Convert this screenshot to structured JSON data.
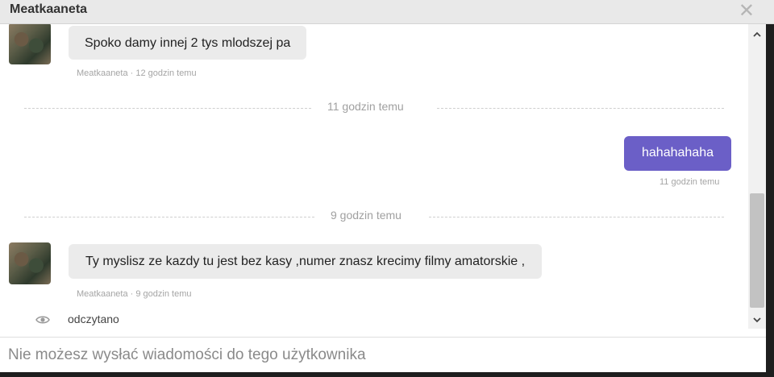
{
  "window": {
    "title": "Meatkaaneta",
    "close_icon": "close-icon"
  },
  "messages": [
    {
      "direction": "in",
      "text": "Spoko damy innej 2 tys mlodszej pa",
      "meta": "Meatkaaneta · 12 godzin temu"
    },
    {
      "direction": "out",
      "text": "hahahahaha",
      "meta": "11 godzin temu"
    },
    {
      "direction": "in",
      "text": "Ty myslisz ze kazdy tu jest bez kasy ,numer znasz krecimy filmy amatorskie ,",
      "meta": "Meatkaaneta · 9 godzin temu"
    }
  ],
  "dividers": [
    {
      "label": "11 godzin temu"
    },
    {
      "label": "9 godzin temu"
    }
  ],
  "read_status": {
    "icon": "eye-icon",
    "text": "odczytano"
  },
  "input": {
    "placeholder": "Nie możesz wysłać wiadomości do tego użytkownika"
  },
  "scrollbar": {
    "up_icon": "chevron-up-icon",
    "down_icon": "chevron-down-icon"
  },
  "colors": {
    "outgoing_bubble": "#6b5fc7",
    "incoming_bubble": "#ebebeb",
    "titlebar": "#e9e9e9"
  }
}
